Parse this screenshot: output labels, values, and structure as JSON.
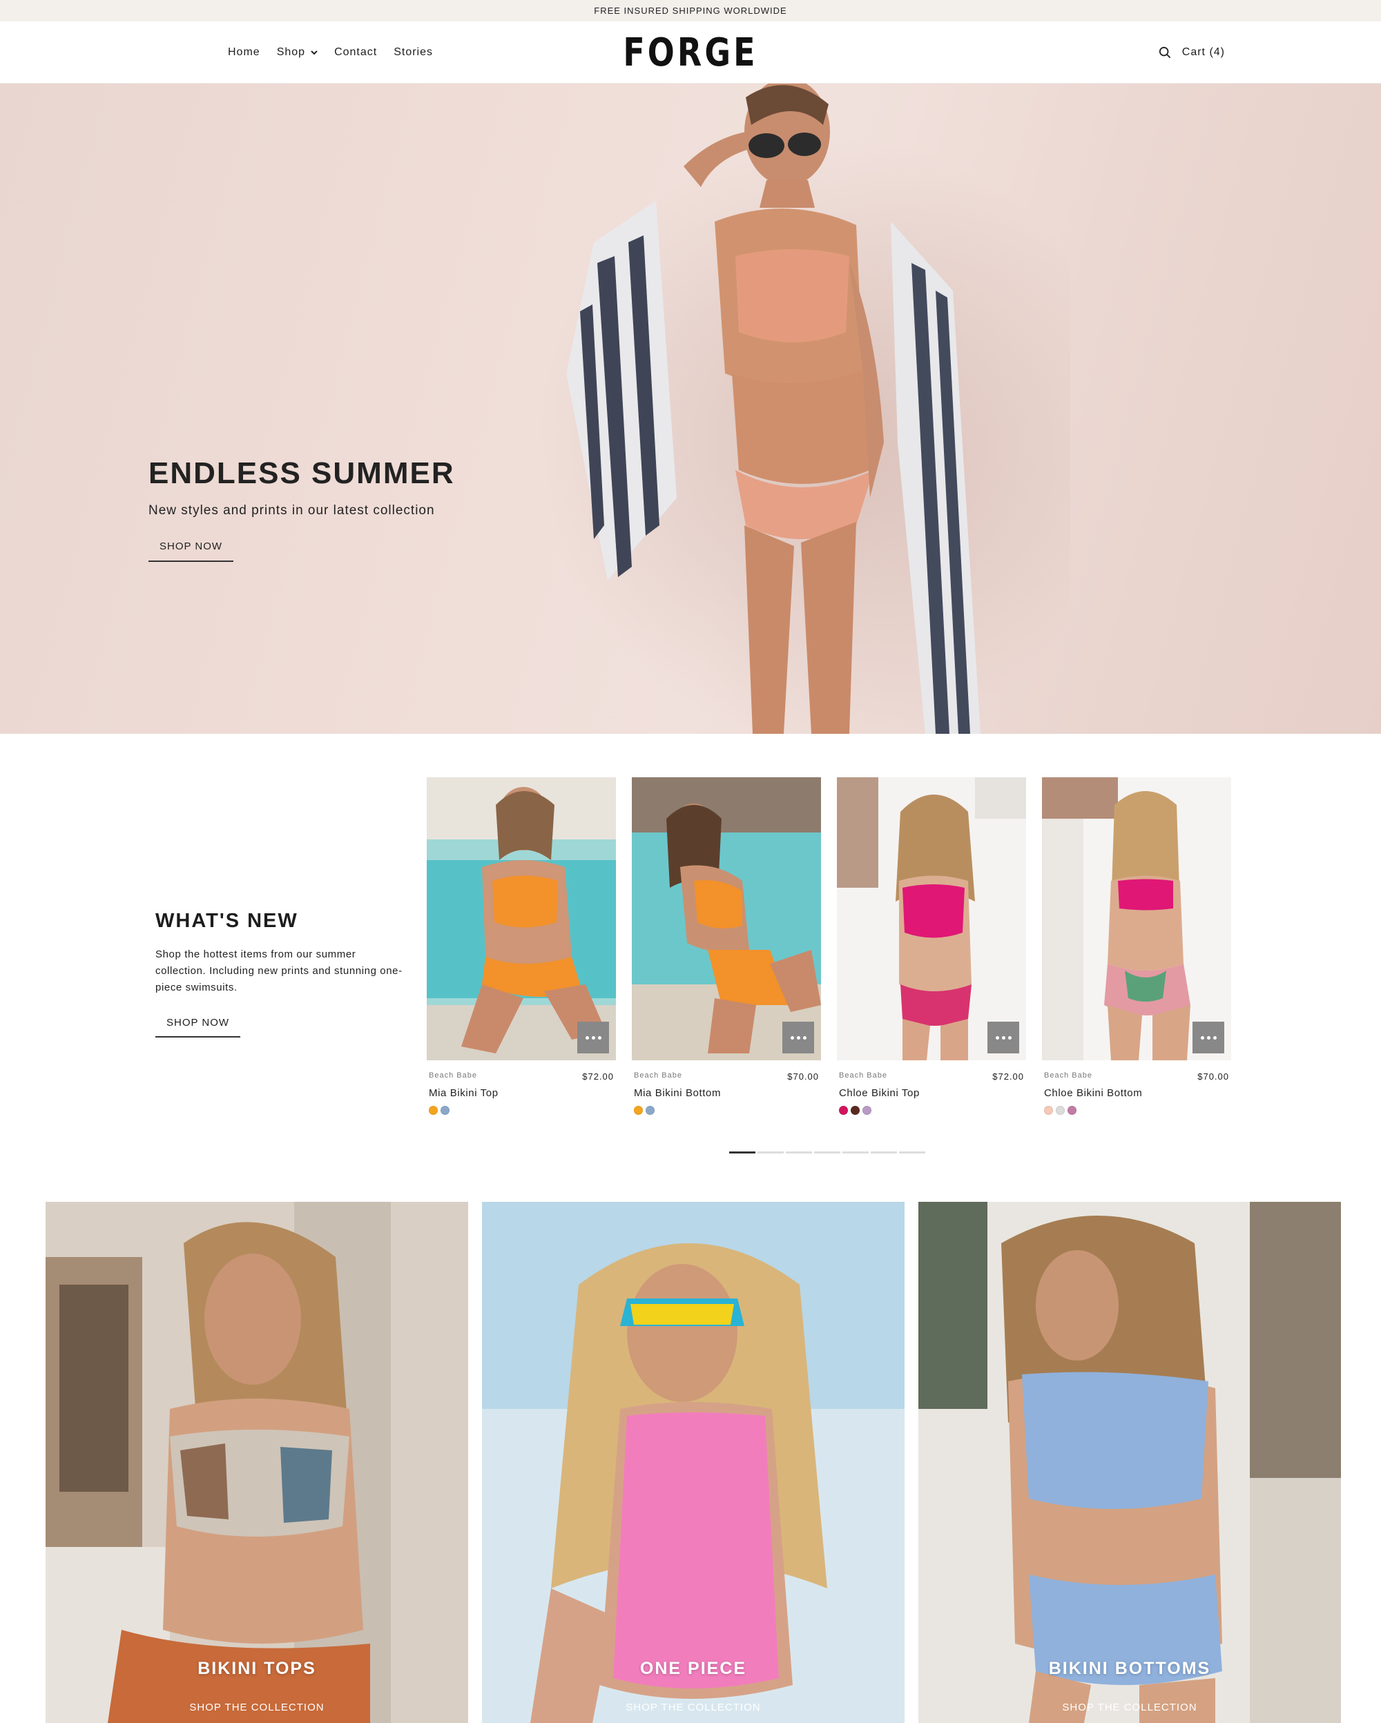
{
  "announcement": "FREE INSURED SHIPPING WORLDWIDE",
  "header": {
    "nav": [
      {
        "label": "Home"
      },
      {
        "label": "Shop"
      },
      {
        "label": "Contact"
      },
      {
        "label": "Stories"
      }
    ],
    "logo": "FORGE",
    "cart_label": "Cart (4)"
  },
  "hero": {
    "title": "ENDLESS SUMMER",
    "subtitle": "New styles and prints in our latest collection",
    "button": "SHOP NOW"
  },
  "whats_new": {
    "title": "WHAT'S NEW",
    "description": "Shop the hottest items from our summer collection. Including new prints and stunning one-piece swimsuits.",
    "button": "SHOP NOW",
    "products": [
      {
        "vendor": "Beach Babe",
        "price": "$72.00",
        "name": "Mia Bikini Top",
        "swatches": [
          "#f3a51e",
          "#8aa7c9"
        ]
      },
      {
        "vendor": "Beach Babe",
        "price": "$70.00",
        "name": "Mia Bikini Bottom",
        "swatches": [
          "#f3a51e",
          "#8aa7c9"
        ]
      },
      {
        "vendor": "Beach Babe",
        "price": "$72.00",
        "name": "Chloe Bikini Top",
        "swatches": [
          "#d2145e",
          "#5a2a1e",
          "#b89ac4"
        ]
      },
      {
        "vendor": "Beach Babe",
        "price": "$70.00",
        "name": "Chloe Bikini Bottom",
        "swatches": [
          "#f4c9b8",
          "#dcdcdc",
          "#c27ba5"
        ]
      }
    ],
    "pager_count": 7,
    "pager_active": 1
  },
  "collections": [
    {
      "title": "BIKINI TOPS",
      "link": "SHOP THE COLLECTION"
    },
    {
      "title": "ONE PIECE",
      "link": "SHOP THE COLLECTION"
    },
    {
      "title": "BIKINI BOTTOMS",
      "link": "SHOP THE COLLECTION"
    }
  ],
  "colors": {
    "announcement_bg": "#f3f0ec",
    "hero_bg": "#efdcd6",
    "text": "#1d1d1d",
    "quick_view_bg": "#888888"
  }
}
